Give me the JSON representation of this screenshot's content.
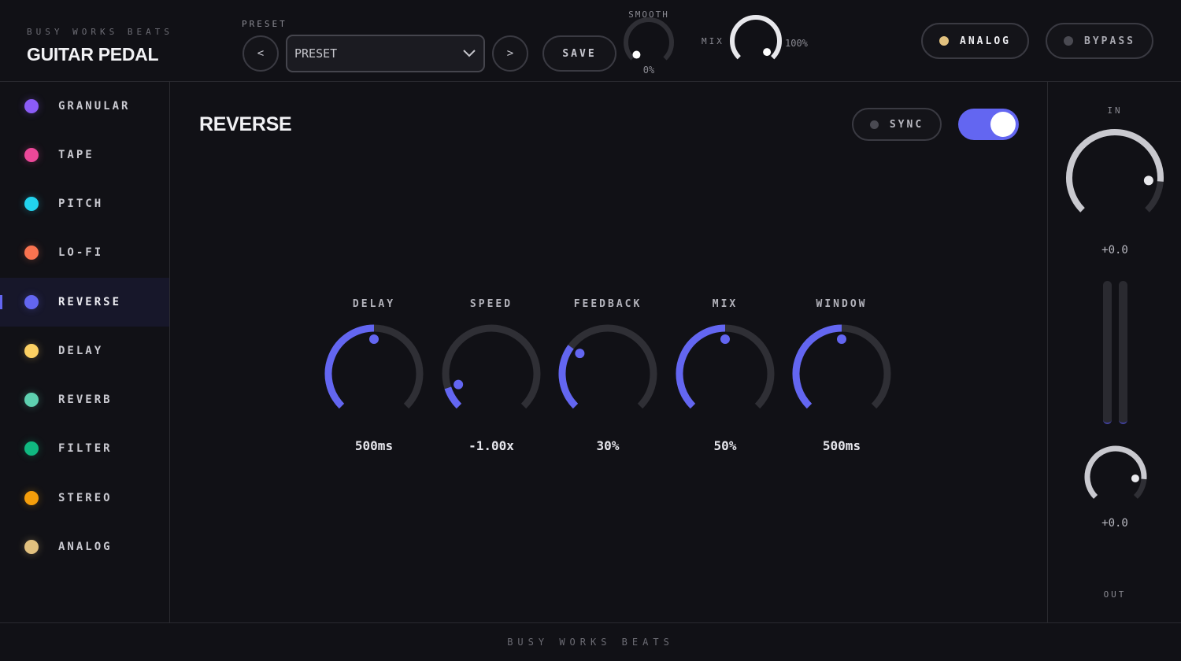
{
  "header": {
    "brand_small": "BUSY WORKS BEATS",
    "brand_title": "GUITAR PEDAL",
    "preset_label": "PRESET",
    "prev_label": "<",
    "next_label": ">",
    "preset_value": "PRESET",
    "save_label": "SAVE",
    "smooth": {
      "label": "SMOOTH",
      "value_text": "0%",
      "value": 0
    },
    "mix": {
      "label": "MIX",
      "value_text": "100%",
      "value": 100
    },
    "analog_label": "ANALOG",
    "bypass_label": "BYPASS"
  },
  "sidebar": {
    "items": [
      {
        "label": "GRANULAR",
        "color": "#8b5cf6",
        "active": false
      },
      {
        "label": "TAPE",
        "color": "#ec4899",
        "active": false
      },
      {
        "label": "PITCH",
        "color": "#22d3ee",
        "active": false
      },
      {
        "label": "LO-FI",
        "color": "#f97350",
        "active": false
      },
      {
        "label": "REVERSE",
        "color": "#6366f1",
        "active": true
      },
      {
        "label": "DELAY",
        "color": "#fcd063",
        "active": false
      },
      {
        "label": "REVERB",
        "color": "#5ed0b0",
        "active": false
      },
      {
        "label": "FILTER",
        "color": "#10b981",
        "active": false
      },
      {
        "label": "STEREO",
        "color": "#f59e0b",
        "active": false
      },
      {
        "label": "ANALOG",
        "color": "#e2c17f",
        "active": false
      }
    ]
  },
  "main": {
    "title": "REVERSE",
    "sync_label": "SYNC",
    "enabled": true,
    "knobs": [
      {
        "label": "DELAY",
        "value_text": "500ms",
        "fraction": 0.5
      },
      {
        "label": "SPEED",
        "value_text": "-1.00x",
        "fraction": 0.1
      },
      {
        "label": "FEEDBACK",
        "value_text": "30%",
        "fraction": 0.3
      },
      {
        "label": "MIX",
        "value_text": "50%",
        "fraction": 0.5
      },
      {
        "label": "WINDOW",
        "value_text": "500ms",
        "fraction": 0.5
      }
    ]
  },
  "right": {
    "in_label": "IN",
    "in_value": "+0.0",
    "out_label": "OUT",
    "out_value": "+0.0",
    "in_fraction": 0.85,
    "out_fraction": 0.85
  },
  "footer": {
    "text": "BUSY WORKS BEATS"
  },
  "colors": {
    "accent": "#6366f1",
    "track": "#2f2f35",
    "white_arc": "#e8e8ec",
    "analog_dot": "#e2c17f",
    "bypass_dot": "#4a4a52"
  }
}
